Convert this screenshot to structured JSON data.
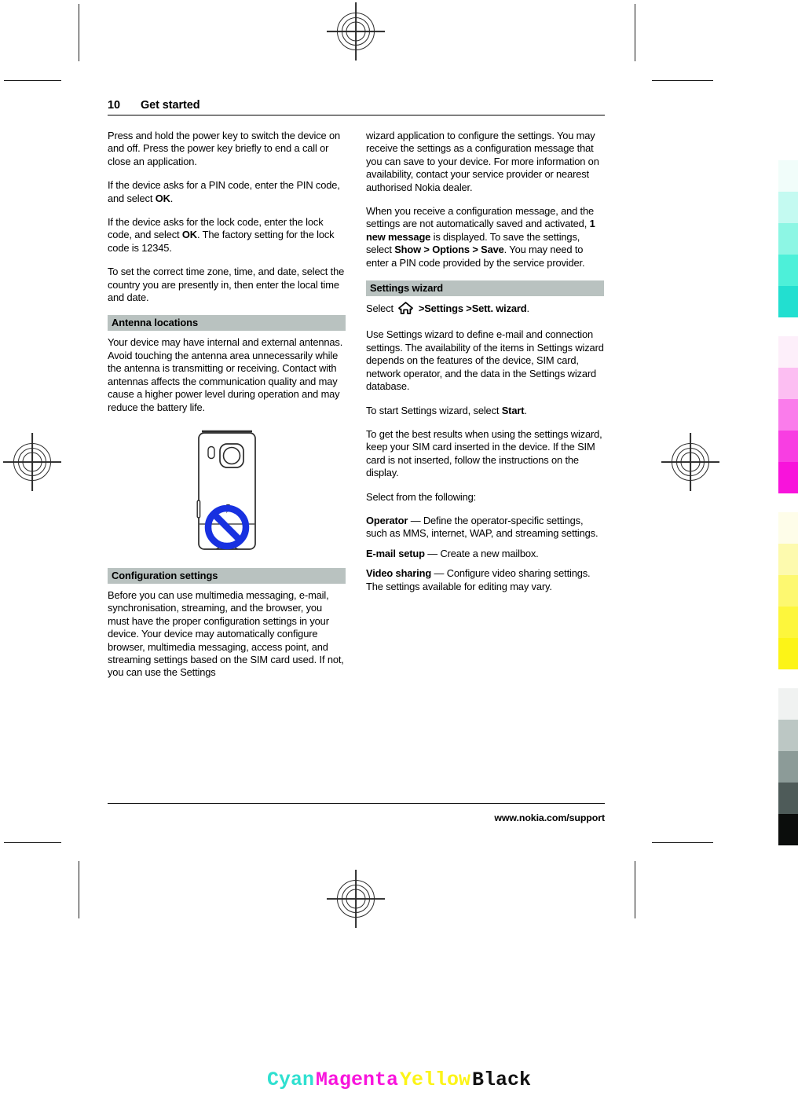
{
  "header": {
    "page_number": "10",
    "section_title": "Get started"
  },
  "left_column": {
    "paragraphs": [
      "Press and hold the power key to switch the device on and off. Press the power key briefly to end a call or close an application.",
      "If the device asks for a PIN code, enter the PIN code, and select OK."
    ],
    "lock_code_para": {
      "part1": "If the device asks for the lock code, enter the lock code, and select ",
      "bold1": "OK",
      "part2": ". The factory setting for the lock code is 12345."
    },
    "time_zone_para": "To set the correct time zone, time, and date, select the country you are presently in, then enter the local time and date.",
    "antenna_heading": "Antenna locations",
    "antenna_para": "Your device may have internal and external antennas. Avoid touching the antenna area unnecessarily while the antenna is transmitting or receiving. Contact with antennas affects the communication quality and may cause a higher power level during operation and may reduce the battery life.",
    "configuration_heading": "Configuration settings",
    "configuration_para": "Before you can use multimedia messaging, e-mail, synchronisation, streaming, and the browser, you must have the proper configuration settings in your device. Your device may automatically configure browser, multimedia messaging, access point, and streaming settings based on the SIM card used. If not, you can use the Settings"
  },
  "right_column": {
    "continuation_para": "wizard application to configure the settings. You may receive the settings as a configuration message that you can save to your device. For more information on availability, contact your service provider or nearest authorised Nokia dealer.",
    "config_message_para": {
      "part1": "When you receive a configuration message, and the settings are not automatically saved and activated, ",
      "bold1": "1 new message",
      "part2": " is displayed. To save the settings, select ",
      "bold2": "Show",
      "sep1": " > ",
      "bold3": "Options",
      "sep2": " > ",
      "bold4": "Save",
      "part3": ". You may need to enter a PIN code provided by the service provider."
    },
    "settings_wizard_heading": "Settings wizard",
    "select_path": {
      "prefix": "Select",
      "icon": "home-icon",
      "sep1": ">",
      "item1": "Settings",
      "sep2": ">",
      "item2": "Sett. wizard",
      "suffix": "."
    },
    "wizard_para": "Use Settings wizard to define e-mail and connection settings. The availability of the items in Settings wizard depends on the features of the device, SIM card, network operator, and the data in the Settings wizard database.",
    "start_para": {
      "part1": "To start Settings wizard, select ",
      "bold1": "Start",
      "part2": "."
    },
    "sim_para": "To get the best results when using the settings wizard, keep your SIM card inserted in the device. If the SIM card is not inserted, follow the instructions on the display.",
    "select_following": "Select from the following:",
    "definitions": [
      {
        "term": "Operator",
        "dash": "—",
        "description": "Define the operator-specific settings, such as MMS, internet, WAP, and streaming settings."
      },
      {
        "term": "E-mail setup",
        "dash": "—",
        "description": "Create a new mailbox."
      },
      {
        "term": "Video sharing",
        "dash": "—",
        "description": "Configure video sharing settings."
      }
    ],
    "closing_para": "The settings available for editing may vary."
  },
  "footer": {
    "url": "www.nokia.com/support"
  },
  "color_calibration": {
    "groups": [
      {
        "name": "cyan",
        "swatches": [
          "#f1fdfa",
          "#c4faf1",
          "#8df6e4",
          "#4df0d9",
          "#22dfd0"
        ]
      },
      {
        "name": "magenta",
        "swatches": [
          "#fdeffa",
          "#fcbef2",
          "#fa7ceb",
          "#f83ee2",
          "#f813db"
        ]
      },
      {
        "name": "yellow",
        "swatches": [
          "#fefde9",
          "#fdfaae",
          "#fdf870",
          "#fdf63c",
          "#fcf417"
        ]
      },
      {
        "name": "black",
        "swatches": [
          "#f0f2f1",
          "#bcc7c4",
          "#8c9b98",
          "#4e5b59",
          "#0b0d0c"
        ]
      }
    ]
  },
  "print_legend": {
    "items": [
      {
        "label": "Cyan",
        "color": "#2fe0d0"
      },
      {
        "label": "Magenta",
        "color": "#f814dc"
      },
      {
        "label": "Yellow",
        "color": "#fcf417"
      },
      {
        "label": "Black",
        "color": "#111111"
      }
    ]
  }
}
